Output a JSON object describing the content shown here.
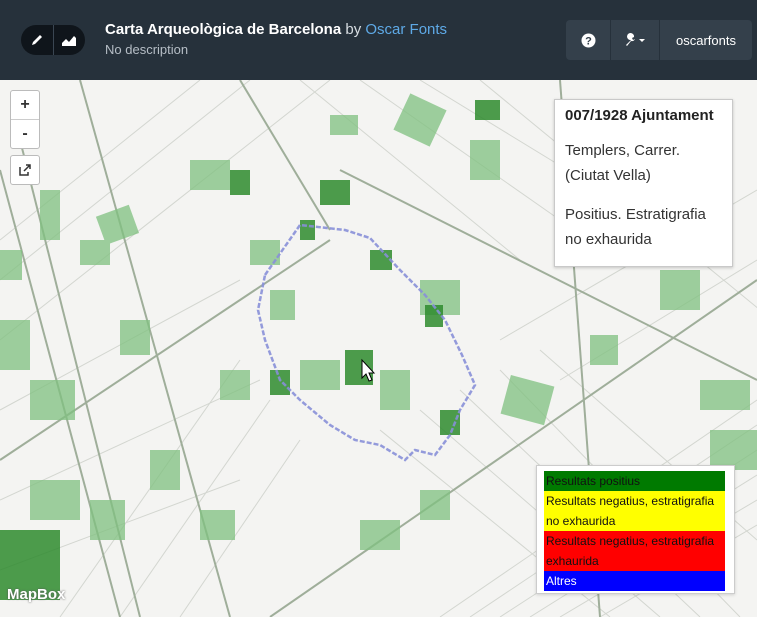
{
  "header": {
    "title": "Carta Arqueològica de Barcelona",
    "by": "by",
    "author": "Oscar Fonts",
    "description": "No description",
    "user": "oscarfonts"
  },
  "icons": {
    "edit": "pencil-icon",
    "chart": "area-chart-icon",
    "help": "question-icon",
    "tools": "wrench-icon",
    "share": "share-icon"
  },
  "map": {
    "zoom_in": "+",
    "zoom_out": "-",
    "attribution": "MapBox"
  },
  "popup": {
    "title": "007/1928 Ajuntament",
    "address": "Templers, Carrer. (Ciutat Vella)",
    "result": "Positius. Estratigrafia no exhaurida"
  },
  "legend": [
    {
      "label": "Resultats positius",
      "color": "#007a00",
      "text_color": "#111111"
    },
    {
      "label": "Resultats negatius, estratigrafia no exhaurida",
      "color": "#ffff00",
      "text_color": "#111111"
    },
    {
      "label": "Resultats negatius, estratigrafia exhaurida",
      "color": "#ff0000",
      "text_color": "#111111"
    },
    {
      "label": "Altres",
      "color": "#0000ff",
      "text_color": "#ffffff"
    }
  ]
}
